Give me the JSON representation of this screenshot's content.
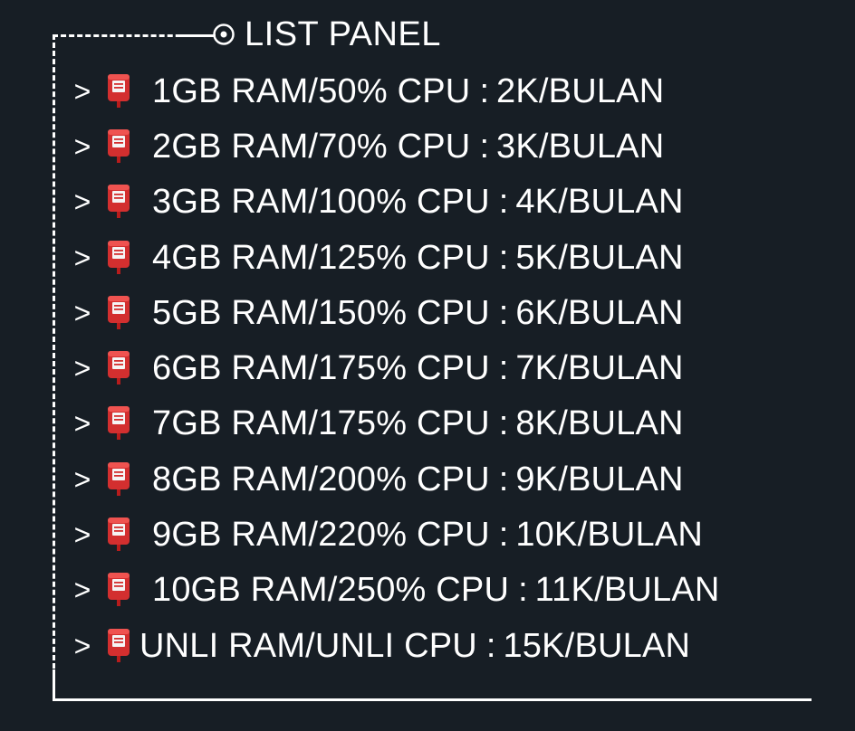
{
  "panel": {
    "title": "LIST PANEL",
    "title_icon": "target-icon",
    "accent_color": "#e53935",
    "items": [
      {
        "arrow": ">",
        "icon": "mailbox-icon",
        "spec": "1GB RAM/50% CPU",
        "separator": ":",
        "price": "2K/BULAN"
      },
      {
        "arrow": ">",
        "icon": "mailbox-icon",
        "spec": "2GB RAM/70% CPU",
        "separator": ":",
        "price": "3K/BULAN"
      },
      {
        "arrow": ">",
        "icon": "mailbox-icon",
        "spec": "3GB RAM/100% CPU",
        "separator": ":",
        "price": "4K/BULAN"
      },
      {
        "arrow": ">",
        "icon": "mailbox-icon",
        "spec": "4GB RAM/125% CPU",
        "separator": ":",
        "price": "5K/BULAN"
      },
      {
        "arrow": ">",
        "icon": "mailbox-icon",
        "spec": "5GB RAM/150% CPU",
        "separator": ":",
        "price": "6K/BULAN"
      },
      {
        "arrow": ">",
        "icon": "mailbox-icon",
        "spec": "6GB RAM/175% CPU",
        "separator": ":",
        "price": "7K/BULAN"
      },
      {
        "arrow": ">",
        "icon": "mailbox-icon",
        "spec": "7GB RAM/175% CPU",
        "separator": ":",
        "price": "8K/BULAN"
      },
      {
        "arrow": ">",
        "icon": "mailbox-icon",
        "spec": "8GB RAM/200% CPU",
        "separator": ":",
        "price": "9K/BULAN"
      },
      {
        "arrow": ">",
        "icon": "mailbox-icon",
        "spec": "9GB RAM/220% CPU",
        "separator": ":",
        "price": "10K/BULAN"
      },
      {
        "arrow": ">",
        "icon": "mailbox-icon",
        "spec": "10GB RAM/250% CPU",
        "separator": ":",
        "price": "11K/BULAN"
      },
      {
        "arrow": ">",
        "icon": "mailbox-icon",
        "spec": "UNLI RAM/UNLI CPU",
        "separator": ":",
        "price": "15K/BULAN"
      }
    ]
  }
}
